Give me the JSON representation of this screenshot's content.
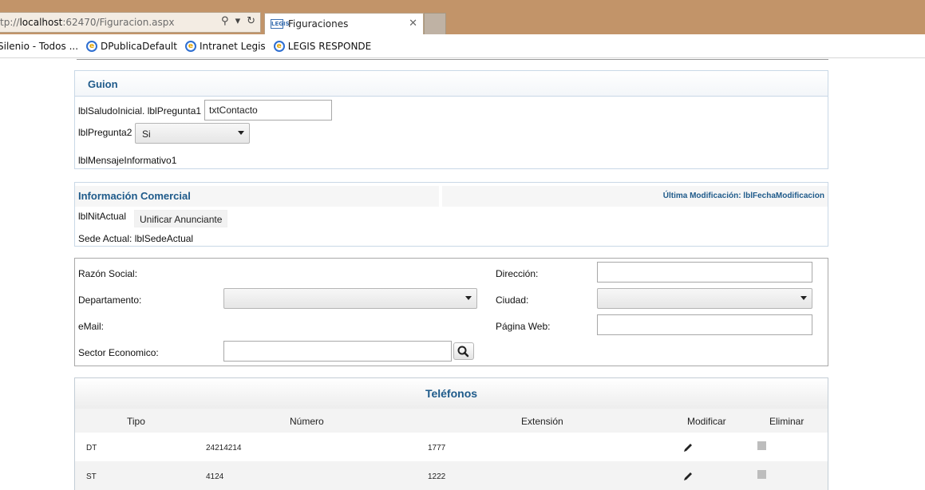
{
  "browser": {
    "url_prefix": "tp://",
    "url_host": "localhost",
    "url_rest": ":62470/Figuracion.aspx",
    "tab_title": "Figuraciones",
    "tab_favicon": "LEGIS",
    "favorites": [
      {
        "label": "Silenio - Todos ..."
      },
      {
        "label": "DPublicaDefault"
      },
      {
        "label": "Intranet Legis"
      },
      {
        "label": "LEGIS RESPONDE"
      }
    ]
  },
  "guion": {
    "title": "Guion",
    "saludo_label": "lblSaludoInicial. lblPregunta1",
    "contacto_value": "txtContacto",
    "pregunta2_label": "lblPregunta2",
    "pregunta2_value": "Si",
    "mensaje_label": "lblMensajeInformativo1"
  },
  "comercial": {
    "title": "Información Comercial",
    "last_modified": "Última Modificación: lblFechaModificacion",
    "nit_label": "lblNitActual",
    "unificar_button": "Unificar Anunciante",
    "sede_label": "Sede Actual: lblSedeActual"
  },
  "form": {
    "razon_social": "Razón Social:",
    "departamento": "Departamento:",
    "email": "eMail:",
    "sector": "Sector Economico:",
    "direccion": "Dirección:",
    "ciudad": "Ciudad:",
    "pagina_web": "Página Web:"
  },
  "telefonos": {
    "title": "Teléfonos",
    "columns": [
      "Tipo",
      "Número",
      "Extensión",
      "Modificar",
      "Eliminar"
    ],
    "rows": [
      {
        "tipo": "DT",
        "numero": "24214214",
        "extension": "1777"
      },
      {
        "tipo": "ST",
        "numero": "4124",
        "extension": "1222"
      }
    ]
  },
  "colors": {
    "chrome": "#c29469",
    "accent": "#1e5a8a"
  }
}
